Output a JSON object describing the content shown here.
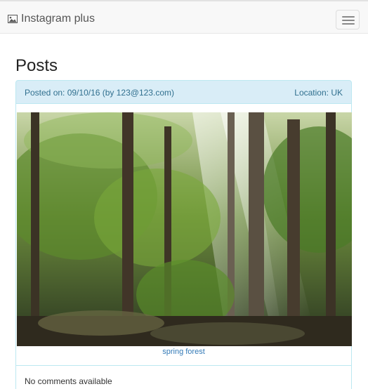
{
  "navbar": {
    "brand_icon": "image-icon",
    "brand": "Instagram plus",
    "toggle_icon": "hamburger-menu-icon"
  },
  "page": {
    "title": "Posts"
  },
  "post": {
    "posted_on": "Posted on: 09/10/16 (by 123@123.com)",
    "location": "Location: UK",
    "image_alt": "photo of a sunlit forest",
    "caption": "spring forest",
    "comments": "No comments available"
  },
  "colors": {
    "panel_heading_bg": "#d9edf7",
    "panel_border": "#bce8f1",
    "panel_heading_text": "#31708f",
    "link": "#337ab7"
  }
}
